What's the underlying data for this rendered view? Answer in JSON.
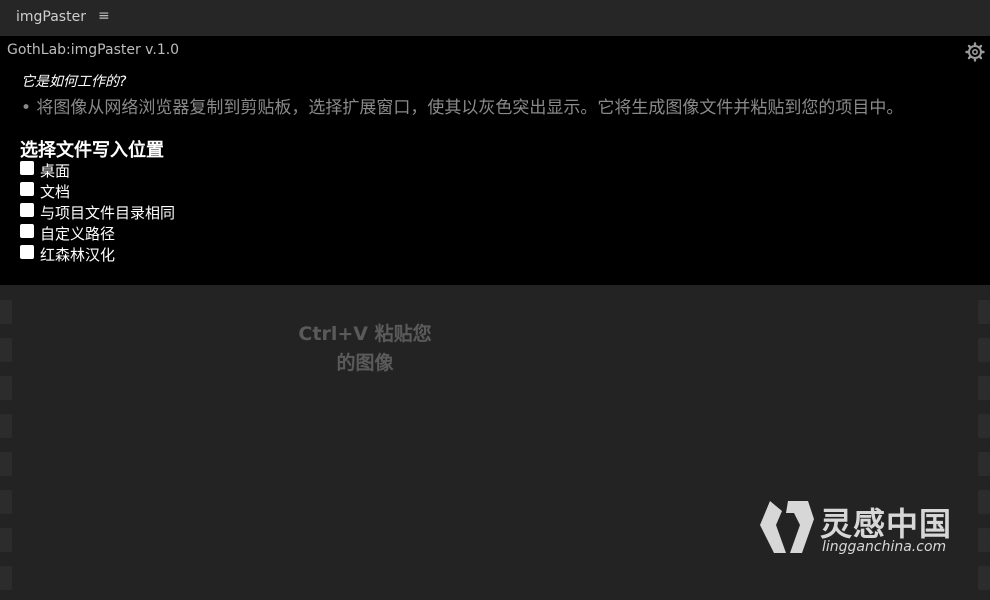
{
  "tab": {
    "title": "imgPaster",
    "menu_icon": "hamburger-icon"
  },
  "header": {
    "version": "GothLab:imgPaster v.1.0",
    "settings_icon": "gear-icon"
  },
  "help": {
    "question": "它是如何工作的?",
    "description": "• 将图像从网络浏览器复制到剪贴板，选择扩展窗口，使其以灰色突出显示。它将生成图像文件并粘贴到您的项目中。"
  },
  "location": {
    "title": "选择文件写入位置",
    "options": [
      {
        "label": "桌面",
        "checked": false
      },
      {
        "label": "文档",
        "checked": false
      },
      {
        "label": "与项目文件目录相同",
        "checked": false
      },
      {
        "label": "自定义路径",
        "checked": false
      },
      {
        "label": "红森林汉化",
        "checked": false
      }
    ]
  },
  "paste": {
    "hint_line1": "Ctrl+V 粘贴您",
    "hint_line2": "的图像"
  },
  "watermark": {
    "brand_cn": "灵感中国",
    "domain": "lingganchina.com",
    "logo_icon": "lg-logo-icon"
  },
  "colors": {
    "info_bg": "#000000",
    "panel_bg": "#232323",
    "hint_text": "#5a5a5a",
    "desc_text": "#8a8a8a"
  }
}
